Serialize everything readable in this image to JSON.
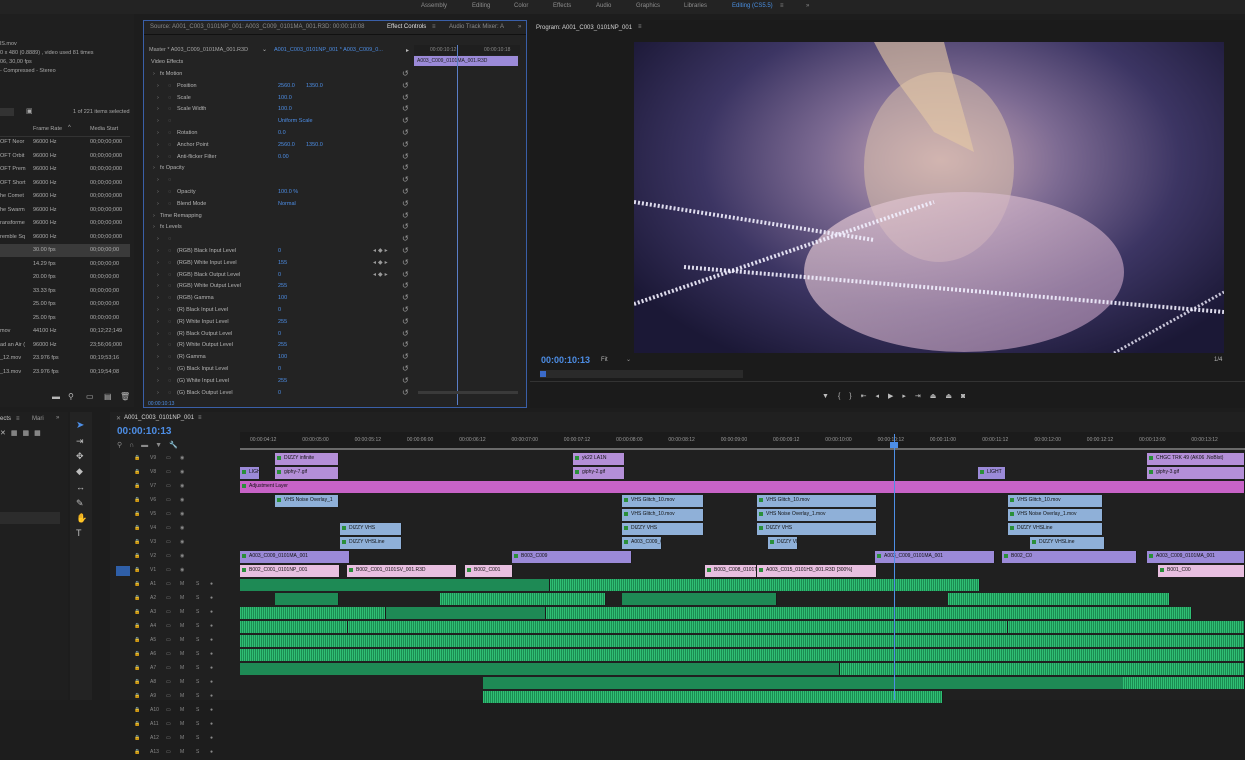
{
  "workspaces": [
    {
      "label": "Assembly",
      "active": false
    },
    {
      "label": "Editing",
      "active": false
    },
    {
      "label": "Color",
      "active": false
    },
    {
      "label": "Effects",
      "active": false
    },
    {
      "label": "Audio",
      "active": false
    },
    {
      "label": "Graphics",
      "active": false
    },
    {
      "label": "Libraries",
      "active": false
    },
    {
      "label": "Editing (CS5.5)",
      "active": true
    }
  ],
  "project": {
    "info": [
      "lS.mov",
      "0 x 480 (0.8889) , video used 81 times",
      "06, 30,00 fps",
      "- Compressed - Stereo"
    ],
    "items_selected": "1 of 221 items selected",
    "col_frame_rate": "Frame Rate",
    "col_media_start": "Media Start",
    "rows": [
      {
        "name": "OFT Neor",
        "rate": "96000 Hz",
        "start": "00;00;00;000"
      },
      {
        "name": "OFT Orbit",
        "rate": "96000 Hz",
        "start": "00;00;00;000"
      },
      {
        "name": "OFT Prem",
        "rate": "96000 Hz",
        "start": "00;00;00;000"
      },
      {
        "name": "OFT Short",
        "rate": "96000 Hz",
        "start": "00;00;00;000"
      },
      {
        "name": "he Comet",
        "rate": "96000 Hz",
        "start": "00;00;00;000"
      },
      {
        "name": "he Swarm",
        "rate": "96000 Hz",
        "start": "00;00;00;000"
      },
      {
        "name": "ransforme",
        "rate": "96000 Hz",
        "start": "00;00;00;000"
      },
      {
        "name": "remble Sq",
        "rate": "96000 Hz",
        "start": "00;00;00;000"
      },
      {
        "name": "",
        "rate": "30.00 fps",
        "start": "00;00;00;00"
      },
      {
        "name": "",
        "rate": "14.29 fps",
        "start": "00;00;00;00"
      },
      {
        "name": "",
        "rate": "20.00 fps",
        "start": "00;00;00;00"
      },
      {
        "name": "",
        "rate": "33.33 fps",
        "start": "00;00;00;00"
      },
      {
        "name": "",
        "rate": "25.00 fps",
        "start": "00;00;00;00"
      },
      {
        "name": "",
        "rate": "25.00 fps",
        "start": "00;00;00;00"
      },
      {
        "name": "mov",
        "rate": "44100 Hz",
        "start": "00;12;22;149"
      },
      {
        "name": "ad an Air (",
        "rate": "96000 Hz",
        "start": "23;56;06;000"
      },
      {
        "name": "_12.mov",
        "rate": "23.976 fps",
        "start": "00;19;53;16"
      },
      {
        "name": "_13.mov",
        "rate": "23.976 fps",
        "start": "00;19;54;08"
      }
    ]
  },
  "effects": {
    "tab_source": "Source: A001_C003_0101NP_001: A003_C009_0101MA_001.R3D: 00:00:10:08",
    "tab_effect_controls": "Effect Controls",
    "tab_audio_mixer": "Audio Track Mixer: A",
    "master": "Master * A003_C009_0101MA_001.R3D",
    "sequence": "A001_C003_0101NP_001 * A003_C009_0...",
    "mini_time1": "00:00:10:12",
    "mini_time2": "00:00:10:18",
    "mini_clip": "A003_C009_0101MA_001.R3D",
    "section_video_effects": "Video Effects",
    "timecode": "00:00:10:13",
    "rows": [
      {
        "indent": 1,
        "label": "fx  Motion",
        "v1": "",
        "v2": ""
      },
      {
        "indent": 2,
        "label": "Position",
        "v1": "2560.0",
        "v2": "1350.0"
      },
      {
        "indent": 2,
        "label": "Scale",
        "v1": "100.0",
        "v2": ""
      },
      {
        "indent": 2,
        "label": "Scale Width",
        "v1": "100.0",
        "v2": ""
      },
      {
        "indent": 2,
        "label": "",
        "v1": "Uniform Scale",
        "v2": ""
      },
      {
        "indent": 2,
        "label": "Rotation",
        "v1": "0.0",
        "v2": ""
      },
      {
        "indent": 2,
        "label": "Anchor Point",
        "v1": "2560.0",
        "v2": "1350.0"
      },
      {
        "indent": 2,
        "label": "Anti-flicker Filter",
        "v1": "0.00",
        "v2": ""
      },
      {
        "indent": 1,
        "label": "fx  Opacity",
        "v1": "",
        "v2": ""
      },
      {
        "indent": 2,
        "label": "",
        "v1": "",
        "v2": ""
      },
      {
        "indent": 2,
        "label": "Opacity",
        "v1": "100.0 %",
        "v2": ""
      },
      {
        "indent": 2,
        "label": "Blend Mode",
        "v1": "Normal",
        "v2": ""
      },
      {
        "indent": 1,
        "label": "Time Remapping",
        "v1": "",
        "v2": ""
      },
      {
        "indent": 1,
        "label": "fx  Levels",
        "v1": "",
        "v2": ""
      },
      {
        "indent": 2,
        "label": "",
        "v1": "",
        "v2": ""
      },
      {
        "indent": 2,
        "label": "(RGB) Black Input Level",
        "v1": "0",
        "v2": ""
      },
      {
        "indent": 2,
        "label": "(RGB) White Input Level",
        "v1": "155",
        "v2": ""
      },
      {
        "indent": 2,
        "label": "(RGB) Black Output Level",
        "v1": "0",
        "v2": ""
      },
      {
        "indent": 2,
        "label": "(RGB) White Output Level",
        "v1": "255",
        "v2": ""
      },
      {
        "indent": 2,
        "label": "(RGB) Gamma",
        "v1": "100",
        "v2": ""
      },
      {
        "indent": 2,
        "label": "(R) Black Input Level",
        "v1": "0",
        "v2": ""
      },
      {
        "indent": 2,
        "label": "(R) White Input Level",
        "v1": "255",
        "v2": ""
      },
      {
        "indent": 2,
        "label": "(R) Black Output Level",
        "v1": "0",
        "v2": ""
      },
      {
        "indent": 2,
        "label": "(R) White Output Level",
        "v1": "255",
        "v2": ""
      },
      {
        "indent": 2,
        "label": "(R) Gamma",
        "v1": "100",
        "v2": ""
      },
      {
        "indent": 2,
        "label": "(G) Black Input Level",
        "v1": "0",
        "v2": ""
      },
      {
        "indent": 2,
        "label": "(G) White Input Level",
        "v1": "255",
        "v2": ""
      },
      {
        "indent": 2,
        "label": "(G) Black Output Level",
        "v1": "0",
        "v2": ""
      }
    ]
  },
  "program": {
    "title": "Program: A001_C003_0101NP_001",
    "timecode": "00:00:10:13",
    "fit": "Fit",
    "resolution": "1/4"
  },
  "timeline": {
    "tab_fx": "ects",
    "tab_mar": "Mari",
    "sequence_tab": "A001_C003_0101NP_001",
    "timecode": "00:00:10:13",
    "ruler": [
      "00:00:04:12",
      "00:00:05:00",
      "00:00:05:12",
      "00:00:06:00",
      "00:00:06:12",
      "00:00:07:00",
      "00:00:07:12",
      "00:00:08:00",
      "00:00:08:12",
      "00:00:09:00",
      "00:00:09:12",
      "00:00:10:00",
      "00:00:10:12",
      "00:00:11:00",
      "00:00:11:12",
      "00:00:12:00",
      "00:00:12:12",
      "00:00:13:00",
      "00:00:13:12"
    ],
    "video_tracks": [
      "V9",
      "V8",
      "V7",
      "V6",
      "V5",
      "V4",
      "V3",
      "V2",
      "V1"
    ],
    "audio_tracks": [
      "A1",
      "A2",
      "A3",
      "A4",
      "A5",
      "A6",
      "A7",
      "A8",
      "A9",
      "A10",
      "A11",
      "A12",
      "A13"
    ],
    "clip_labels": [
      "DIZZY infinite",
      "giphy-7.gif",
      "yk22 LA1N",
      "giphy-2.gif",
      "CHGC TRK 49 (AK06 .NoBlst)",
      "giphy-3.gif",
      "LIGHT",
      "Adjustment Layer",
      "VHS Noise Overlay_1",
      "VHS Glitch_10.mov",
      "VHS Glitch_10.mov",
      "VHS Glitch_10.mov",
      "VHS Noise Overlay_1.mov",
      "VHS Noise Overlay_1.mov",
      "DIZZY VHS",
      "VHS Glitch_10.mov",
      "DIZZY VHSLine",
      "A003_C009_0101MA_001",
      "B002_C001_0101NP_001",
      "B003_C009",
      "A003_C015_0101H3_001.R3D [300%]",
      "A003_C009_0101MA_001.R3D",
      "B003_C008_0101TB_001.R3D",
      "B002_C001",
      "B002_C001_0101SV_001.R3D",
      "B002_C0",
      "B001_C00"
    ]
  }
}
